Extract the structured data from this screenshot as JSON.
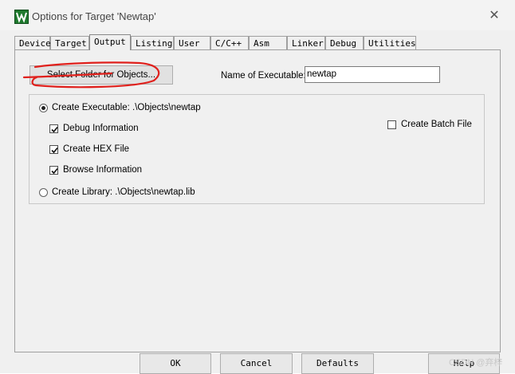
{
  "window": {
    "title": "Options for Target 'Newtap'",
    "close_glyph": "✕"
  },
  "tabs": [
    {
      "label": "Device"
    },
    {
      "label": "Target"
    },
    {
      "label": "Output"
    },
    {
      "label": "Listing"
    },
    {
      "label": "User"
    },
    {
      "label": "C/C++"
    },
    {
      "label": "Asm"
    },
    {
      "label": "Linker"
    },
    {
      "label": "Debug"
    },
    {
      "label": "Utilities"
    }
  ],
  "active_tab": "Output",
  "output": {
    "select_folder_label": "Select Folder for Objects...",
    "name_of_executable_label": "Name of Executable:",
    "name_of_executable_value": "newtap",
    "create_executable_label": "Create Executable:  .\\Objects\\newtap",
    "create_executable_selected": true,
    "debug_information_label": "Debug Information",
    "debug_information_checked": true,
    "create_hex_label": "Create HEX File",
    "create_hex_checked": true,
    "browse_information_label": "Browse Information",
    "browse_information_checked": true,
    "create_batch_label": "Create Batch File",
    "create_batch_checked": false,
    "create_library_label": "Create Library:  .\\Objects\\newtap.lib",
    "create_library_selected": false
  },
  "buttons": {
    "ok": "OK",
    "cancel": "Cancel",
    "defaults": "Defaults",
    "help": "Help"
  },
  "watermark": "CSDN @弃梓",
  "colors": {
    "annotation_red": "#e0201c",
    "app_icon_green": "#1f7a2e"
  }
}
